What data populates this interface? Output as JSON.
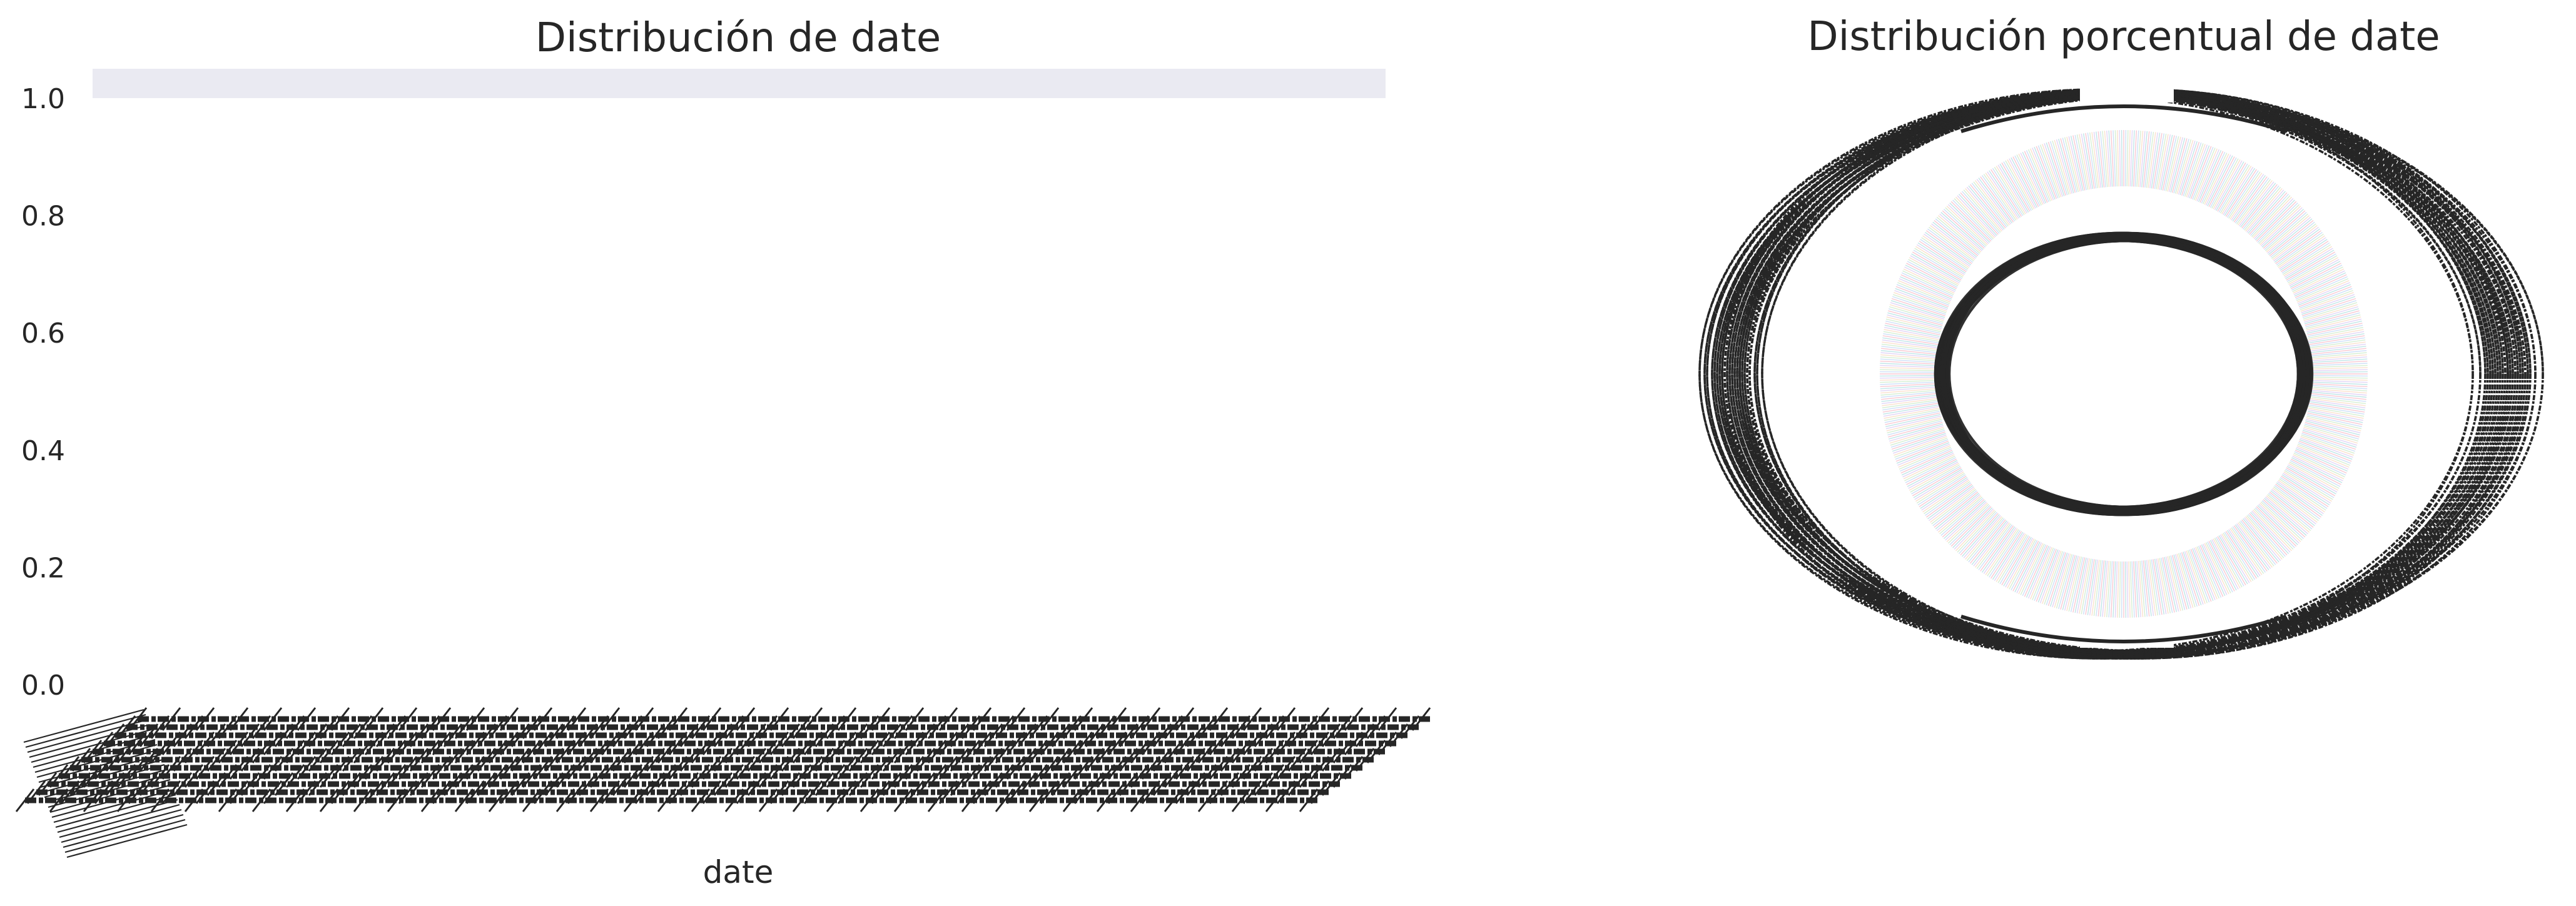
{
  "chart_data": [
    {
      "type": "bar",
      "title": "Distribución de date",
      "xlabel": "date",
      "ylabel": "",
      "ylim": [
        0,
        1.05
      ],
      "yticks": [
        "0.0",
        "0.2",
        "0.4",
        "0.6",
        "0.8",
        "1.0"
      ],
      "value_range": [
        1.0,
        1.05
      ],
      "tick_labels_note": "",
      "grid": false,
      "background": "#ffffff",
      "bar_color": "#eaeaf2"
    },
    {
      "type": "pie",
      "title": "Distribución porcentual de date",
      "grid": false,
      "colors": [
        "#f29db0",
        "#a7c8f2",
        "#b5e2b0",
        "#f7c9a5",
        "#cbb3ef",
        "#8fd0d6"
      ],
      "text_color": "#262626"
    }
  ]
}
